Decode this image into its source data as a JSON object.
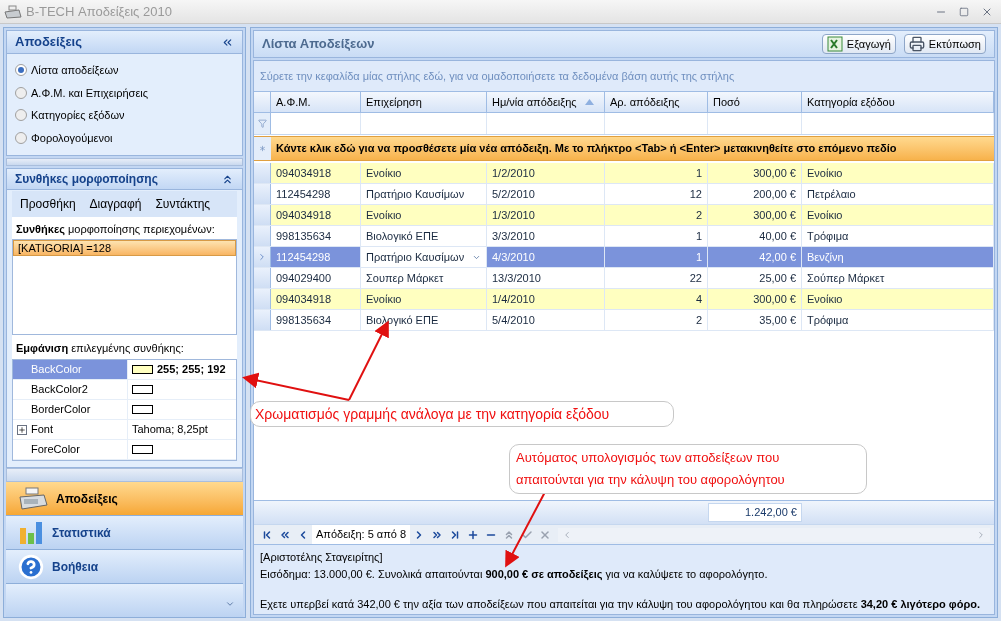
{
  "window": {
    "title": "B-TECH Αποδείξεις 2010"
  },
  "left_panel": {
    "title": "Αποδείξεις",
    "options": [
      {
        "label": "Λίστα αποδείξεων",
        "selected": true
      },
      {
        "label": "Α.Φ.Μ. και Επιχειρήσεις",
        "selected": false
      },
      {
        "label": "Κατηγορίες εξόδων",
        "selected": false
      },
      {
        "label": "Φορολογούμενοι",
        "selected": false
      }
    ]
  },
  "formatting": {
    "title": "Συνθήκες μορφοποίησης",
    "toolbar": [
      "Προσθήκη",
      "Διαγραφή",
      "Συντάκτης"
    ],
    "conditions_label": "**Συνθήκες** μορφοποίησης περιεχομένων:",
    "conditions": [
      {
        "text": "[KATIGORIA] =128",
        "selected": true
      }
    ],
    "appearance_label": "**Εμφάνιση** επιλεγμένης συνθήκης:",
    "properties": [
      {
        "name": "BackColor",
        "kind": "color",
        "color": "#ffffc0",
        "value": "255; 255; 192",
        "selected": true
      },
      {
        "name": "BackColor2",
        "kind": "color",
        "color": "#ffffff",
        "selected": false
      },
      {
        "name": "BorderColor",
        "kind": "color",
        "color": "#ffffff",
        "selected": false
      },
      {
        "name": "Font",
        "kind": "text",
        "value": "Tahoma; 8,25pt",
        "expandable": true,
        "selected": false
      },
      {
        "name": "ForeColor",
        "kind": "color",
        "color": "#ffffff",
        "selected": false
      }
    ]
  },
  "navigation": [
    {
      "label": "Αποδείξεις",
      "kind": "register",
      "selected": true
    },
    {
      "label": "Στατιστικά",
      "kind": "chart",
      "selected": false
    },
    {
      "label": "Βοήθεια",
      "kind": "help",
      "selected": false
    }
  ],
  "main": {
    "title": "Λίστα Αποδείξεων",
    "buttons": [
      {
        "label": "Εξαγωγή",
        "kind": "excel"
      },
      {
        "label": "Εκτύπωση",
        "kind": "print"
      }
    ],
    "group_hint": "Σύρετε την κεφαλίδα μίας στήλης εδώ, για να ομαδοποιήσετε τα δεδομένα βάση αυτής της στήλης",
    "columns": [
      {
        "label": "Α.Φ.Μ.",
        "sorted": false
      },
      {
        "label": "Επιχείρηση",
        "sorted": false
      },
      {
        "label": "Ημ/νία απόδειξης",
        "sorted": true
      },
      {
        "label": "Αρ. απόδειξης",
        "sorted": false
      },
      {
        "label": "Ποσό",
        "sorted": false
      },
      {
        "label": "Κατηγορία εξόδου",
        "sorted": false
      }
    ],
    "new_row": "Κάντε κλικ εδώ για να προσθέσετε μία νέα απόδειξη. Με το πλήκτρο <Tab> ή <Enter> μετακινηθείτε στο επόμενο πεδίο",
    "rows": [
      {
        "cells": [
          "094034918",
          "Ενοίκιο",
          "1/2/2010",
          "1",
          "300,00 €",
          "Ενοίκιο"
        ],
        "highlighted": true,
        "selected": false
      },
      {
        "cells": [
          "112454298",
          "Πρατήριο Καυσίμων",
          "5/2/2010",
          "12",
          "200,00 €",
          "Πετρέλαιο"
        ],
        "highlighted": false,
        "selected": false
      },
      {
        "cells": [
          "094034918",
          "Ενοίκιο",
          "1/3/2010",
          "2",
          "300,00 €",
          "Ενοίκιο"
        ],
        "highlighted": true,
        "selected": false
      },
      {
        "cells": [
          "998135634",
          "Βιολογικό ΕΠΕ",
          "3/3/2010",
          "1",
          "40,00 €",
          "Τρόφιμα"
        ],
        "highlighted": false,
        "selected": false
      },
      {
        "cells": [
          "112454298",
          "Πρατήριο Καυσίμων",
          "4/3/2010",
          "1",
          "42,00 €",
          "Βενζίνη"
        ],
        "selected": true
      },
      {
        "cells": [
          "094029400",
          "Σουπερ Μάρκετ",
          "13/3/2010",
          "22",
          "25,00 €",
          "Σούπερ Μάρκετ"
        ],
        "highlighted": false,
        "selected": false
      },
      {
        "cells": [
          "094034918",
          "Ενοίκιο",
          "1/4/2010",
          "4",
          "300,00 €",
          "Ενοίκιο"
        ],
        "highlighted": true,
        "selected": false
      },
      {
        "cells": [
          "998135634",
          "Βιολογικό ΕΠΕ",
          "5/4/2010",
          "2",
          "35,00 €",
          "Τρόφιμα"
        ],
        "highlighted": false,
        "selected": false
      }
    ],
    "total": "1.242,00 €",
    "navigator": "Απόδειξη: 5 από 8",
    "info": [
      "[Αριστοτέλης Σταγειρίτης]",
      "Εισόδημα: 13.000,00 €. Συνολικά απαιτούνται **900,00 € σε αποδείξεις** για να καλύψετε το αφορολόγητο.",
      "Εχετε υπερβεί κατά 342,00 € την αξία των αποδείξεων που απαιτείται για την κάλυψη του αφορολόγητου και θα πληρώσετε **34,20 € λιγότερο φόρο.**"
    ]
  },
  "annotations": [
    "Χρωματισμός γραμμής ανάλογα με την κατηγορία εξόδου",
    "Αυτόματος υπολογισμός των αποδείξεων που απαιτούνται για την κάλυψη του αφορολόγητου"
  ]
}
